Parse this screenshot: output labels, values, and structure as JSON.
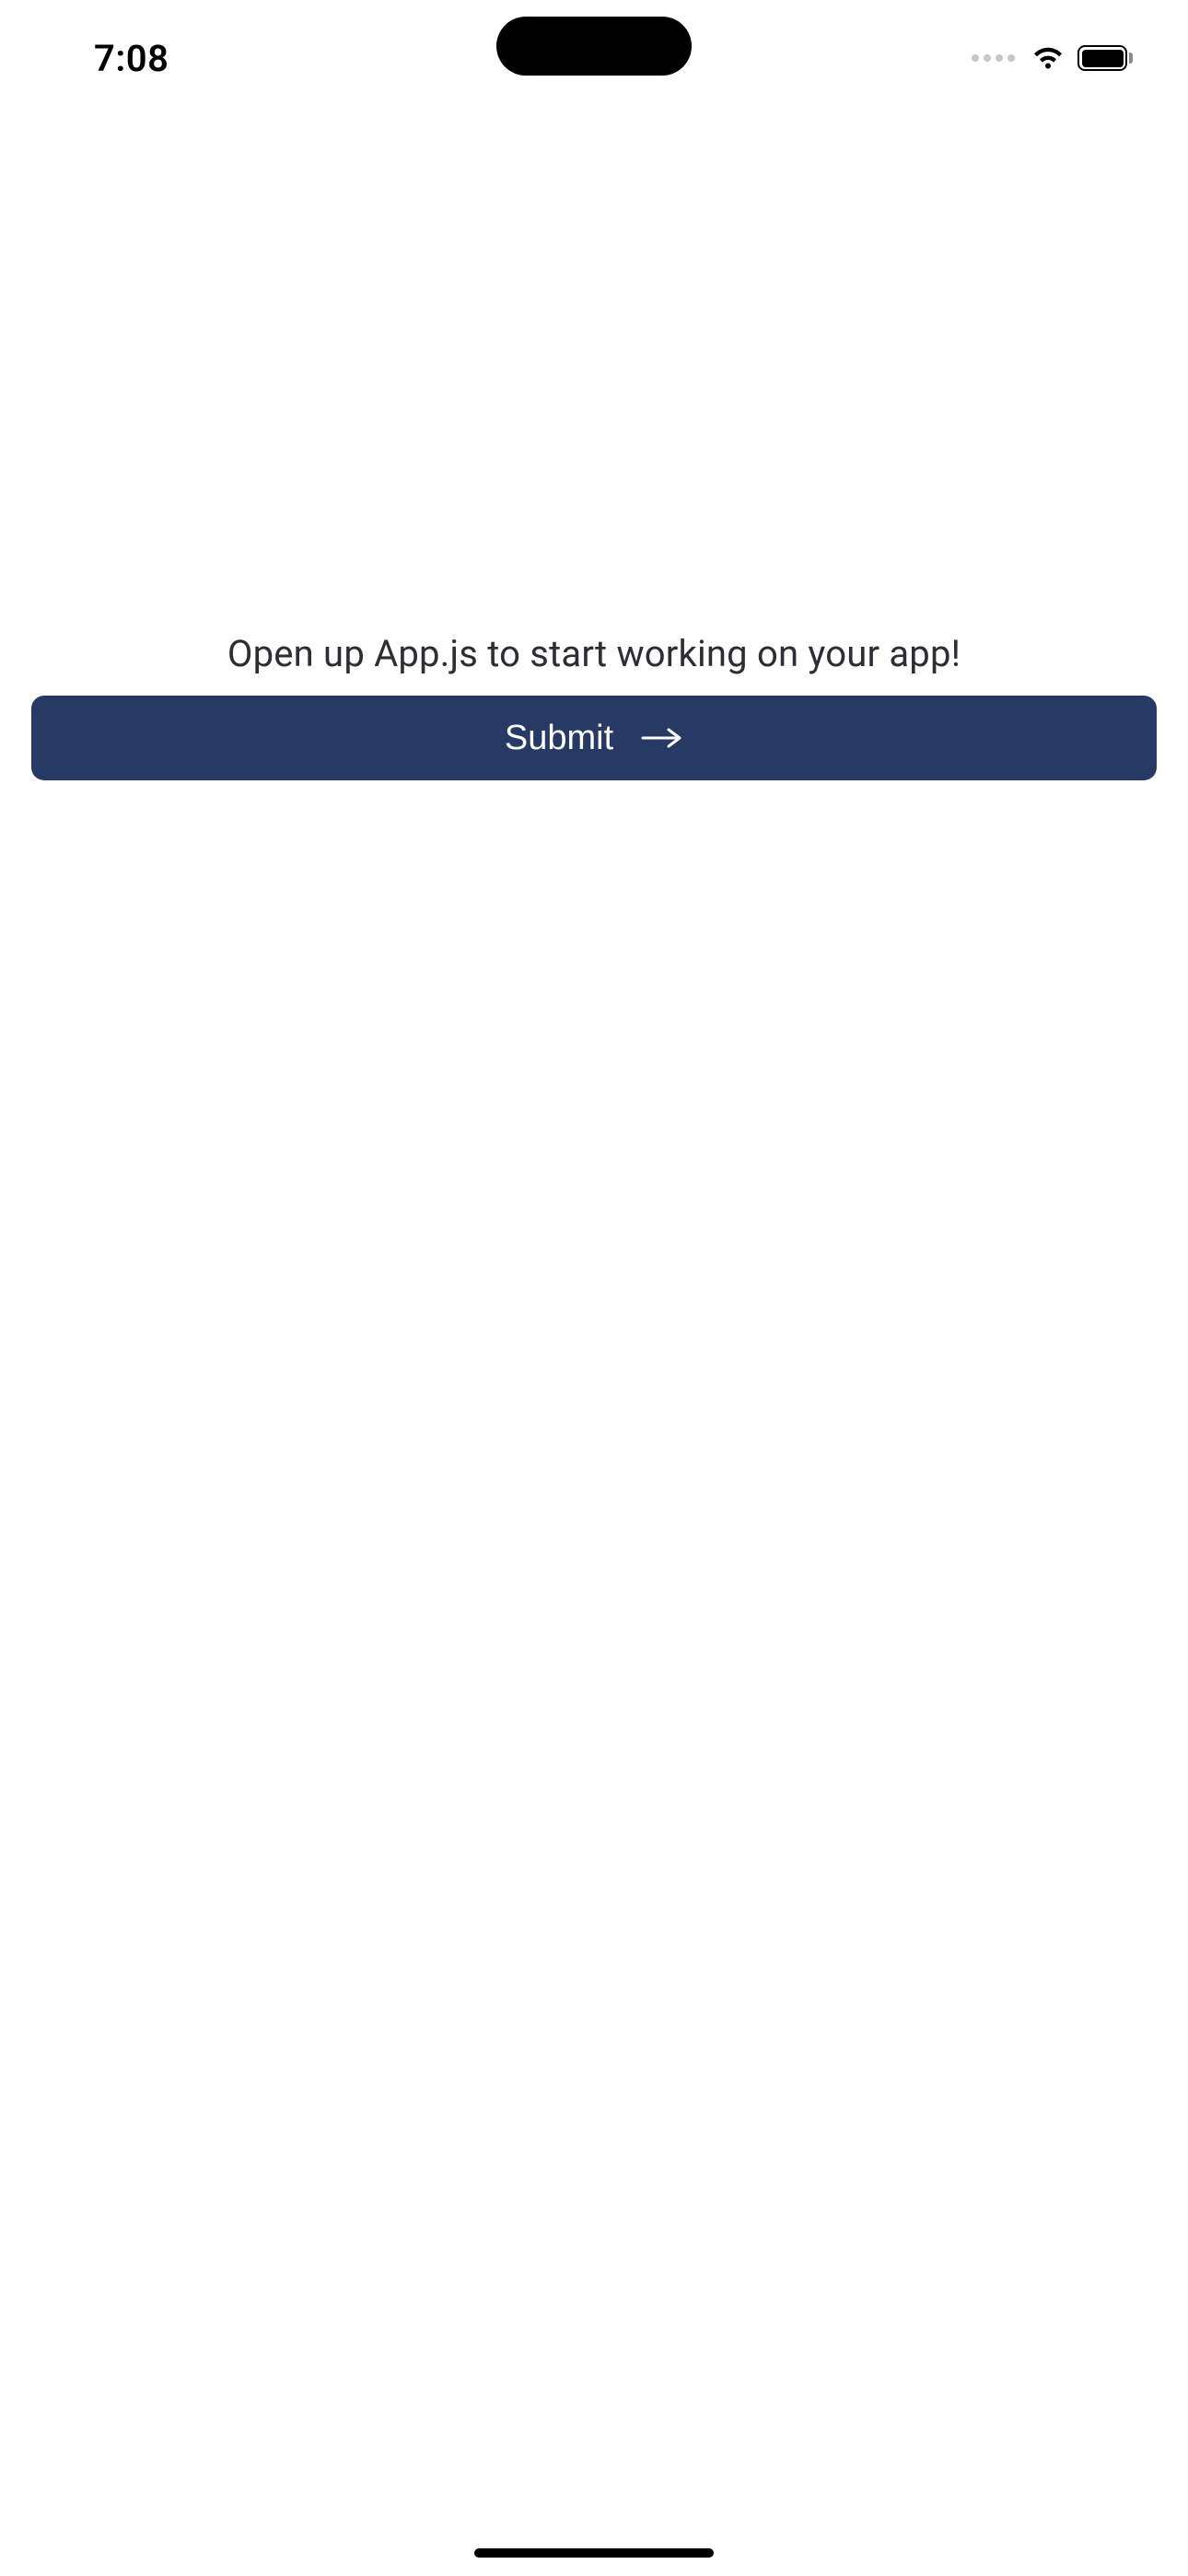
{
  "status_bar": {
    "time": "7:08"
  },
  "main": {
    "message": "Open up App.js to start working on your app!"
  },
  "button": {
    "submit_label": "Submit"
  },
  "colors": {
    "button_bg": "#273a66",
    "button_text": "#ffffff",
    "text": "#2d2d34"
  }
}
